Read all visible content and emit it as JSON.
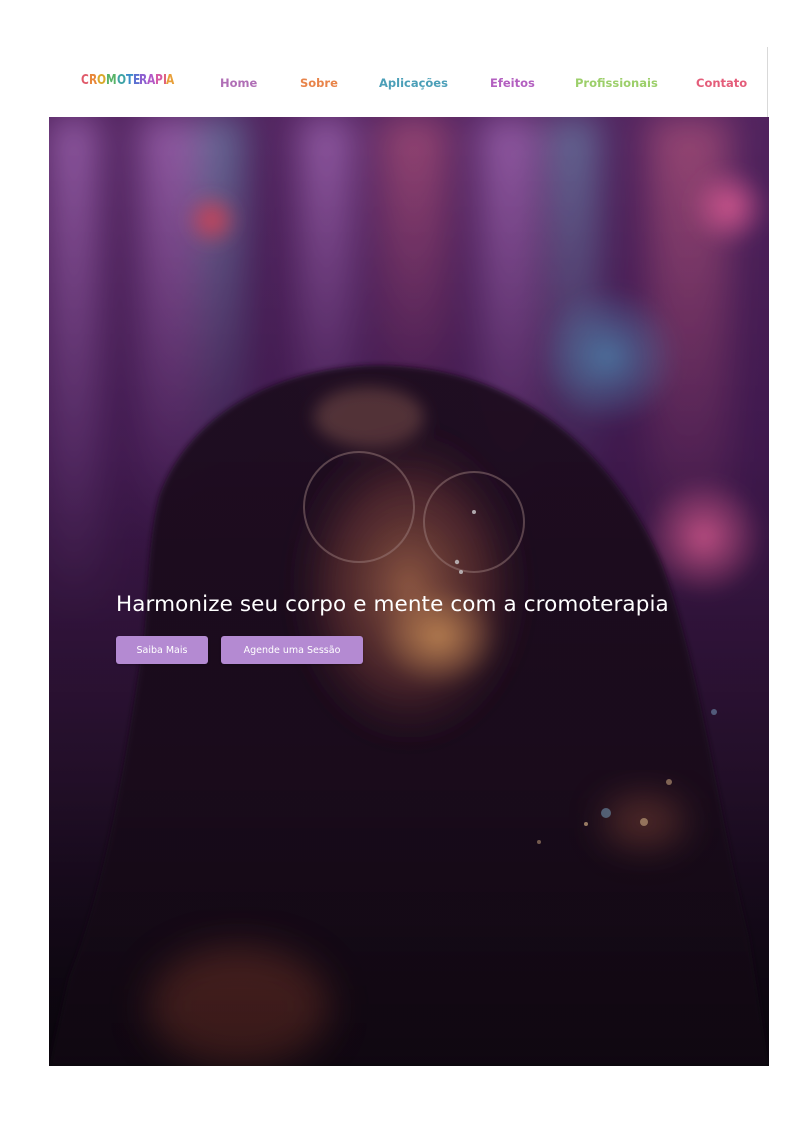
{
  "logo": {
    "letters": [
      {
        "char": "C",
        "color": "#e05a6a"
      },
      {
        "char": "R",
        "color": "#e8873a"
      },
      {
        "char": "O",
        "color": "#d9a92b"
      },
      {
        "char": "M",
        "color": "#58b368"
      },
      {
        "char": "O",
        "color": "#3ea3a6"
      },
      {
        "char": "T",
        "color": "#3a8ec9"
      },
      {
        "char": "E",
        "color": "#5b6fd1"
      },
      {
        "char": "R",
        "color": "#8c5fd0"
      },
      {
        "char": "A",
        "color": "#b25ac8"
      },
      {
        "char": "P",
        "color": "#d65aa5"
      },
      {
        "char": "I",
        "color": "#e0607a"
      },
      {
        "char": "A",
        "color": "#e8a03a"
      }
    ]
  },
  "nav": {
    "home": {
      "label": "Home",
      "color": "#b06fb6"
    },
    "sobre": {
      "label": "Sobre",
      "color": "#e8844a"
    },
    "aplicacoes": {
      "label": "Aplicações",
      "color": "#4b9fb8"
    },
    "efeitos": {
      "label": "Efeitos",
      "color": "#b35fc0"
    },
    "profissionais": {
      "label": "Profissionais",
      "color": "#9ccf6a"
    },
    "contato": {
      "label": "Contato",
      "color": "#e45d7a"
    }
  },
  "hero": {
    "title": "Harmonize seu corpo e mente com a cromoterapia",
    "button_primary": "Saiba Mais",
    "button_secondary": "Agende uma Sessão",
    "button_color": "#b48ad2"
  }
}
